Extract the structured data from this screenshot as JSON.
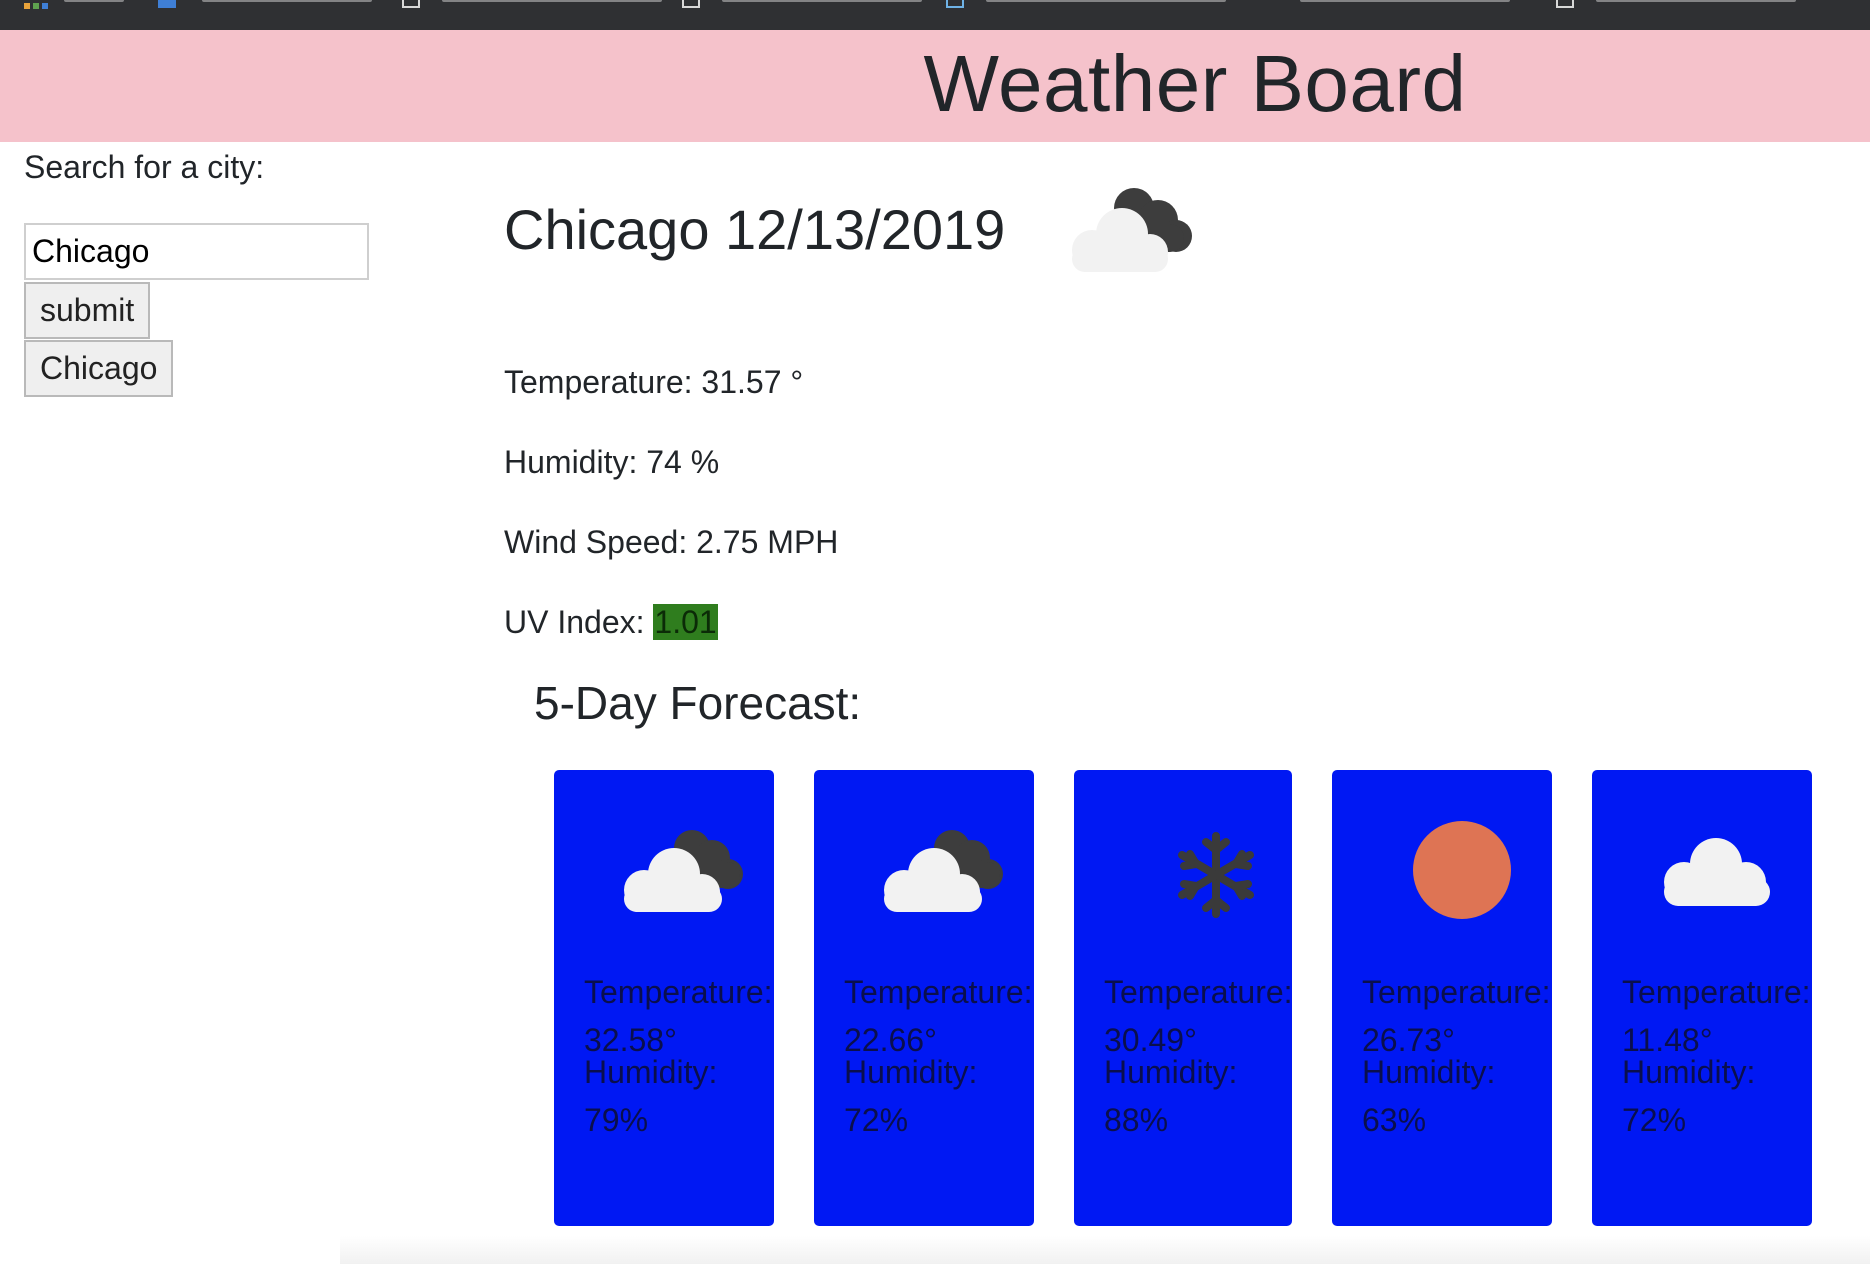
{
  "header": {
    "title": "Weather Board"
  },
  "search": {
    "label": "Search for a city:",
    "value": "Chicago",
    "submit_label": "submit",
    "history": [
      "Chicago"
    ]
  },
  "current": {
    "heading": "Chicago 12/13/2019",
    "icon": "partly-cloudy-icon",
    "temperature": "Temperature: 31.57 °",
    "humidity": "Humidity: 74 %",
    "wind": "Wind Speed: 2.75 MPH",
    "uv_label": "UV Index: ",
    "uv_value": "1.01",
    "uv_color": "#2f7d1e"
  },
  "forecast": {
    "title": "5-Day Forecast:",
    "card_color": "#0018f3",
    "days": [
      {
        "icon": "partly-cloudy-icon",
        "temp_label": "Temperature:",
        "temp": "32.58°",
        "hum_label": "Humidity:",
        "hum": "79%"
      },
      {
        "icon": "partly-cloudy-icon",
        "temp_label": "Temperature:",
        "temp": "22.66°",
        "hum_label": "Humidity:",
        "hum": "72%"
      },
      {
        "icon": "snowflake-icon",
        "temp_label": "Temperature:",
        "temp": "30.49°",
        "hum_label": "Humidity:",
        "hum": "88%"
      },
      {
        "icon": "sun-icon",
        "temp_label": "Temperature:",
        "temp": "26.73°",
        "hum_label": "Humidity:",
        "hum": "63%"
      },
      {
        "icon": "cloud-icon",
        "temp_label": "Temperature:",
        "temp": "11.48°",
        "hum_label": "Humidity:",
        "hum": "72%"
      }
    ]
  }
}
